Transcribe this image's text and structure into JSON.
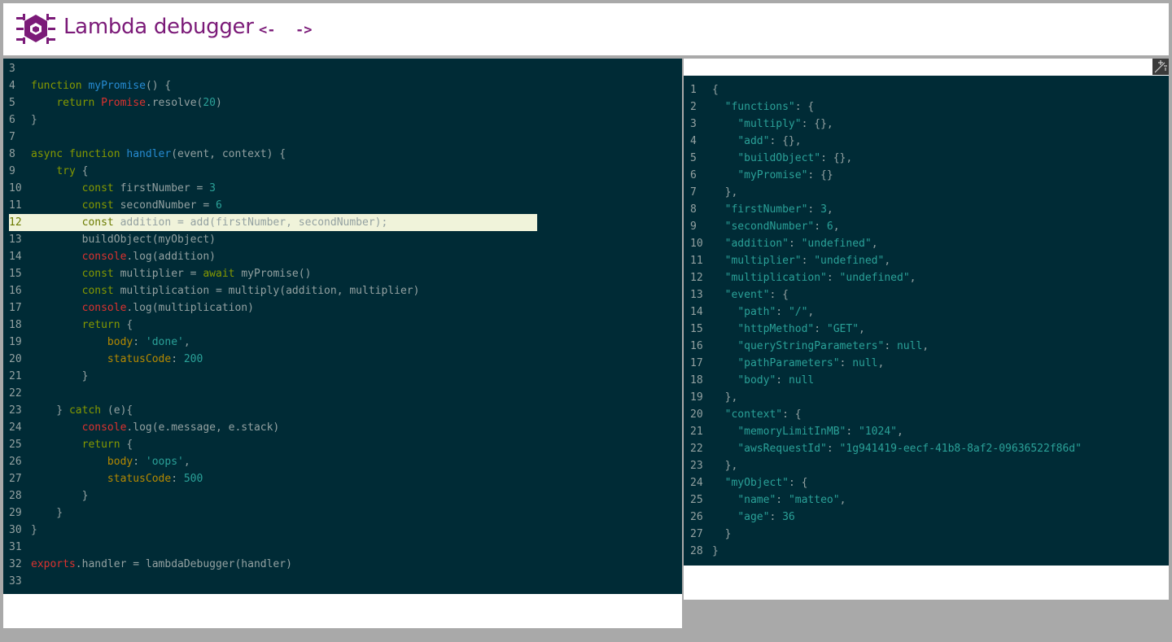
{
  "app": {
    "title": "Lambda debugger",
    "nav_back_label": "<-",
    "nav_forward_label": "->",
    "logo_icon": "bug-icon",
    "accent_color": "#7b1a78"
  },
  "editor": {
    "background_color": "#002b36",
    "highlight_color": "#f0f3da",
    "current_line": 12,
    "lines": [
      {
        "n": "3",
        "tokens": []
      },
      {
        "n": "4",
        "tokens": [
          [
            "kw",
            "function "
          ],
          [
            "fn",
            "myPromise"
          ],
          [
            "def",
            "() {"
          ]
        ]
      },
      {
        "n": "5",
        "tokens": [
          [
            "def",
            "    "
          ],
          [
            "kw",
            "return "
          ],
          [
            "red",
            "Promise"
          ],
          [
            "def",
            ".resolve("
          ],
          [
            "num",
            "20"
          ],
          [
            "def",
            ")"
          ]
        ]
      },
      {
        "n": "6",
        "tokens": [
          [
            "def",
            "}"
          ]
        ]
      },
      {
        "n": "7",
        "tokens": []
      },
      {
        "n": "8",
        "tokens": [
          [
            "kw",
            "async function "
          ],
          [
            "fn",
            "handler"
          ],
          [
            "def",
            "(event, context) {"
          ]
        ]
      },
      {
        "n": "9",
        "tokens": [
          [
            "def",
            "    "
          ],
          [
            "kw",
            "try"
          ],
          [
            "def",
            " {"
          ]
        ]
      },
      {
        "n": "10",
        "tokens": [
          [
            "def",
            "        "
          ],
          [
            "kw",
            "const "
          ],
          [
            "def",
            "firstNumber = "
          ],
          [
            "num",
            "3"
          ]
        ]
      },
      {
        "n": "11",
        "tokens": [
          [
            "def",
            "        "
          ],
          [
            "kw",
            "const "
          ],
          [
            "def",
            "secondNumber = "
          ],
          [
            "num",
            "6"
          ]
        ]
      },
      {
        "n": "12",
        "tokens": [
          [
            "def",
            "        "
          ],
          [
            "kw",
            "const "
          ],
          [
            "def",
            "addition = add(firstNumber, secondNumber);"
          ]
        ]
      },
      {
        "n": "13",
        "tokens": [
          [
            "def",
            "        buildObject(myObject)"
          ]
        ]
      },
      {
        "n": "14",
        "tokens": [
          [
            "def",
            "        "
          ],
          [
            "red",
            "console"
          ],
          [
            "def",
            ".log(addition)"
          ]
        ]
      },
      {
        "n": "15",
        "tokens": [
          [
            "def",
            "        "
          ],
          [
            "kw",
            "const "
          ],
          [
            "def",
            "multiplier = "
          ],
          [
            "kw",
            "await "
          ],
          [
            "def",
            "myPromise()"
          ]
        ]
      },
      {
        "n": "16",
        "tokens": [
          [
            "def",
            "        "
          ],
          [
            "kw",
            "const "
          ],
          [
            "def",
            "multiplication = multiply(addition, multiplier)"
          ]
        ]
      },
      {
        "n": "17",
        "tokens": [
          [
            "def",
            "        "
          ],
          [
            "red",
            "console"
          ],
          [
            "def",
            ".log(multiplication)"
          ]
        ]
      },
      {
        "n": "18",
        "tokens": [
          [
            "def",
            "        "
          ],
          [
            "kw",
            "return"
          ],
          [
            "def",
            " {"
          ]
        ]
      },
      {
        "n": "19",
        "tokens": [
          [
            "def",
            "            "
          ],
          [
            "prop",
            "body"
          ],
          [
            "def",
            ": "
          ],
          [
            "str",
            "'done'"
          ],
          [
            "def",
            ","
          ]
        ]
      },
      {
        "n": "20",
        "tokens": [
          [
            "def",
            "            "
          ],
          [
            "prop",
            "statusCode"
          ],
          [
            "def",
            ": "
          ],
          [
            "num",
            "200"
          ]
        ]
      },
      {
        "n": "21",
        "tokens": [
          [
            "def",
            "        }"
          ]
        ]
      },
      {
        "n": "22",
        "tokens": []
      },
      {
        "n": "23",
        "tokens": [
          [
            "def",
            "    } "
          ],
          [
            "kw",
            "catch"
          ],
          [
            "def",
            " (e){"
          ]
        ]
      },
      {
        "n": "24",
        "tokens": [
          [
            "def",
            "        "
          ],
          [
            "red",
            "console"
          ],
          [
            "def",
            ".log(e.message, e.stack)"
          ]
        ]
      },
      {
        "n": "25",
        "tokens": [
          [
            "def",
            "        "
          ],
          [
            "kw",
            "return"
          ],
          [
            "def",
            " {"
          ]
        ]
      },
      {
        "n": "26",
        "tokens": [
          [
            "def",
            "            "
          ],
          [
            "prop",
            "body"
          ],
          [
            "def",
            ": "
          ],
          [
            "str",
            "'oops'"
          ],
          [
            "def",
            ","
          ]
        ]
      },
      {
        "n": "27",
        "tokens": [
          [
            "def",
            "            "
          ],
          [
            "prop",
            "statusCode"
          ],
          [
            "def",
            ": "
          ],
          [
            "num",
            "500"
          ]
        ]
      },
      {
        "n": "28",
        "tokens": [
          [
            "def",
            "        }"
          ]
        ]
      },
      {
        "n": "29",
        "tokens": [
          [
            "def",
            "    }"
          ]
        ]
      },
      {
        "n": "30",
        "tokens": [
          [
            "def",
            "}"
          ]
        ]
      },
      {
        "n": "31",
        "tokens": []
      },
      {
        "n": "32",
        "tokens": [
          [
            "red",
            "exports"
          ],
          [
            "def",
            ".handler = lambdaDebugger(handler)"
          ]
        ]
      },
      {
        "n": "33",
        "tokens": []
      }
    ]
  },
  "state_viewer": {
    "expand_icon": "expand-icon",
    "lines": [
      {
        "n": "1",
        "tokens": [
          [
            "def",
            "{"
          ]
        ]
      },
      {
        "n": "2",
        "tokens": [
          [
            "def",
            "  "
          ],
          [
            "key",
            "\"functions\""
          ],
          [
            "def",
            ": {"
          ]
        ]
      },
      {
        "n": "3",
        "tokens": [
          [
            "def",
            "    "
          ],
          [
            "key",
            "\"multiply\""
          ],
          [
            "def",
            ": {},"
          ]
        ]
      },
      {
        "n": "4",
        "tokens": [
          [
            "def",
            "    "
          ],
          [
            "key",
            "\"add\""
          ],
          [
            "def",
            ": {},"
          ]
        ]
      },
      {
        "n": "5",
        "tokens": [
          [
            "def",
            "    "
          ],
          [
            "key",
            "\"buildObject\""
          ],
          [
            "def",
            ": {},"
          ]
        ]
      },
      {
        "n": "6",
        "tokens": [
          [
            "def",
            "    "
          ],
          [
            "key",
            "\"myPromise\""
          ],
          [
            "def",
            ": {}"
          ]
        ]
      },
      {
        "n": "7",
        "tokens": [
          [
            "def",
            "  },"
          ]
        ]
      },
      {
        "n": "8",
        "tokens": [
          [
            "def",
            "  "
          ],
          [
            "key",
            "\"firstNumber\""
          ],
          [
            "def",
            ": "
          ],
          [
            "num",
            "3"
          ],
          [
            "def",
            ","
          ]
        ]
      },
      {
        "n": "9",
        "tokens": [
          [
            "def",
            "  "
          ],
          [
            "key",
            "\"secondNumber\""
          ],
          [
            "def",
            ": "
          ],
          [
            "num",
            "6"
          ],
          [
            "def",
            ","
          ]
        ]
      },
      {
        "n": "10",
        "tokens": [
          [
            "def",
            "  "
          ],
          [
            "key",
            "\"addition\""
          ],
          [
            "def",
            ": "
          ],
          [
            "str",
            "\"undefined\""
          ],
          [
            "def",
            ","
          ]
        ]
      },
      {
        "n": "11",
        "tokens": [
          [
            "def",
            "  "
          ],
          [
            "key",
            "\"multiplier\""
          ],
          [
            "def",
            ": "
          ],
          [
            "str",
            "\"undefined\""
          ],
          [
            "def",
            ","
          ]
        ]
      },
      {
        "n": "12",
        "tokens": [
          [
            "def",
            "  "
          ],
          [
            "key",
            "\"multiplication\""
          ],
          [
            "def",
            ": "
          ],
          [
            "str",
            "\"undefined\""
          ],
          [
            "def",
            ","
          ]
        ]
      },
      {
        "n": "13",
        "tokens": [
          [
            "def",
            "  "
          ],
          [
            "key",
            "\"event\""
          ],
          [
            "def",
            ": {"
          ]
        ]
      },
      {
        "n": "14",
        "tokens": [
          [
            "def",
            "    "
          ],
          [
            "key",
            "\"path\""
          ],
          [
            "def",
            ": "
          ],
          [
            "str",
            "\"/\""
          ],
          [
            "def",
            ","
          ]
        ]
      },
      {
        "n": "15",
        "tokens": [
          [
            "def",
            "    "
          ],
          [
            "key",
            "\"httpMethod\""
          ],
          [
            "def",
            ": "
          ],
          [
            "str",
            "\"GET\""
          ],
          [
            "def",
            ","
          ]
        ]
      },
      {
        "n": "16",
        "tokens": [
          [
            "def",
            "    "
          ],
          [
            "key",
            "\"queryStringParameters\""
          ],
          [
            "def",
            ": "
          ],
          [
            "num",
            "null"
          ],
          [
            "def",
            ","
          ]
        ]
      },
      {
        "n": "17",
        "tokens": [
          [
            "def",
            "    "
          ],
          [
            "key",
            "\"pathParameters\""
          ],
          [
            "def",
            ": "
          ],
          [
            "num",
            "null"
          ],
          [
            "def",
            ","
          ]
        ]
      },
      {
        "n": "18",
        "tokens": [
          [
            "def",
            "    "
          ],
          [
            "key",
            "\"body\""
          ],
          [
            "def",
            ": "
          ],
          [
            "num",
            "null"
          ]
        ]
      },
      {
        "n": "19",
        "tokens": [
          [
            "def",
            "  },"
          ]
        ]
      },
      {
        "n": "20",
        "tokens": [
          [
            "def",
            "  "
          ],
          [
            "key",
            "\"context\""
          ],
          [
            "def",
            ": {"
          ]
        ]
      },
      {
        "n": "21",
        "tokens": [
          [
            "def",
            "    "
          ],
          [
            "key",
            "\"memoryLimitInMB\""
          ],
          [
            "def",
            ": "
          ],
          [
            "str",
            "\"1024\""
          ],
          [
            "def",
            ","
          ]
        ]
      },
      {
        "n": "22",
        "tokens": [
          [
            "def",
            "    "
          ],
          [
            "key",
            "\"awsRequestId\""
          ],
          [
            "def",
            ": "
          ],
          [
            "str",
            "\"1g941419-eecf-41b8-8af2-09636522f86d\""
          ]
        ]
      },
      {
        "n": "23",
        "tokens": [
          [
            "def",
            "  },"
          ]
        ]
      },
      {
        "n": "24",
        "tokens": [
          [
            "def",
            "  "
          ],
          [
            "key",
            "\"myObject\""
          ],
          [
            "def",
            ": {"
          ]
        ]
      },
      {
        "n": "25",
        "tokens": [
          [
            "def",
            "    "
          ],
          [
            "key",
            "\"name\""
          ],
          [
            "def",
            ": "
          ],
          [
            "str",
            "\"matteo\""
          ],
          [
            "def",
            ","
          ]
        ]
      },
      {
        "n": "26",
        "tokens": [
          [
            "def",
            "    "
          ],
          [
            "key",
            "\"age\""
          ],
          [
            "def",
            ": "
          ],
          [
            "num",
            "36"
          ]
        ]
      },
      {
        "n": "27",
        "tokens": [
          [
            "def",
            "  }"
          ]
        ]
      },
      {
        "n": "28",
        "tokens": [
          [
            "def",
            "}"
          ]
        ]
      }
    ]
  }
}
